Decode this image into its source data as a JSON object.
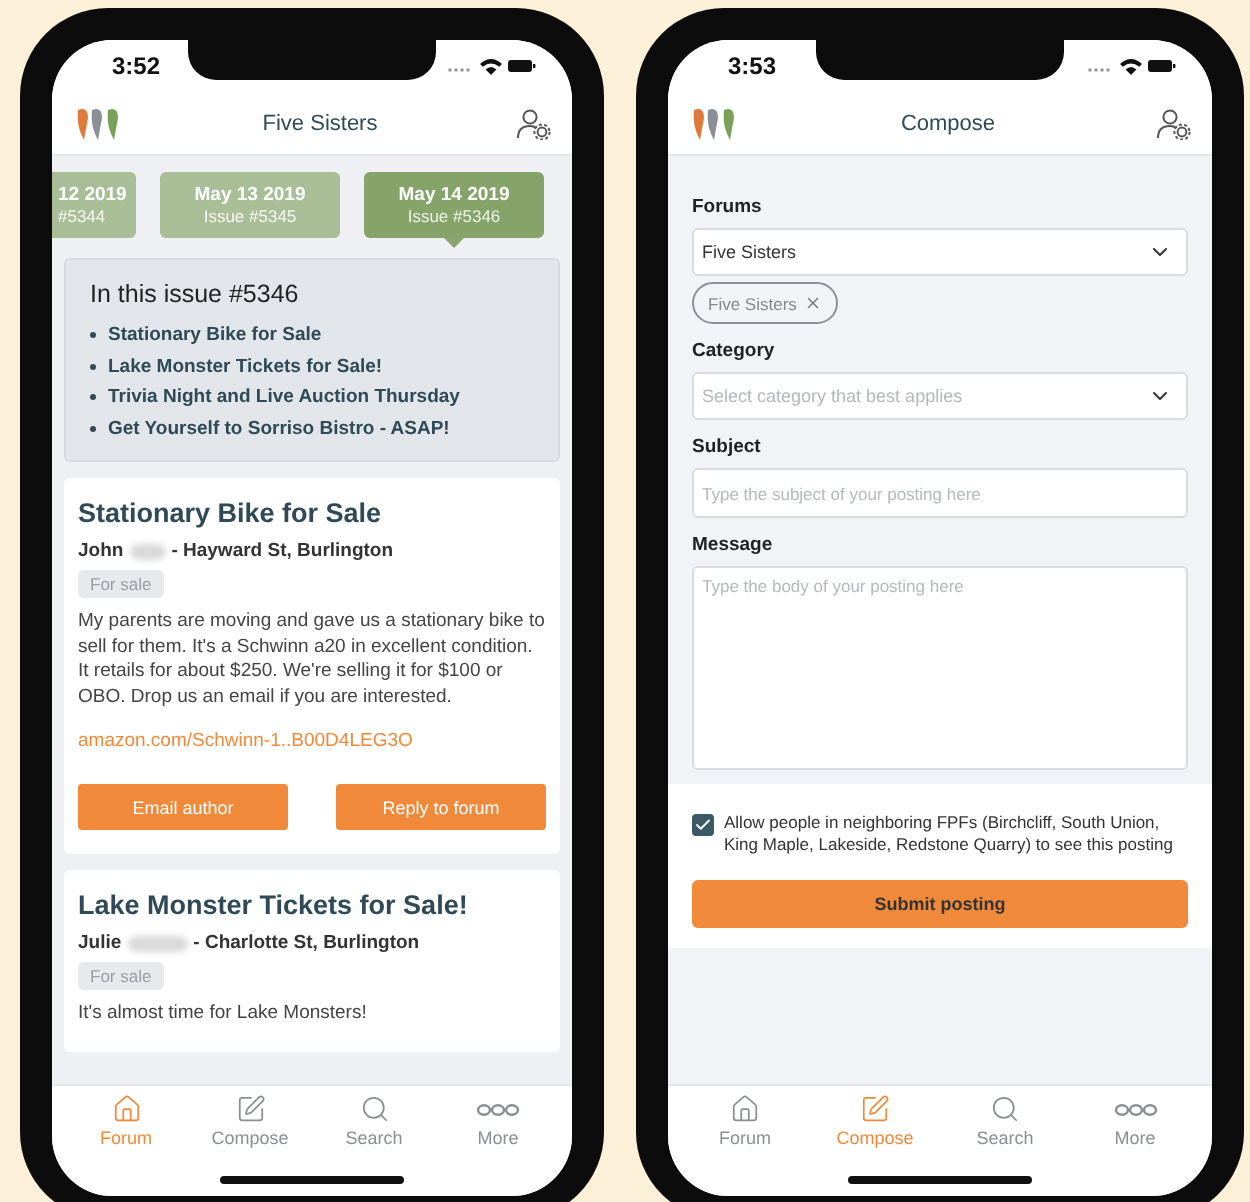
{
  "forum_screen": {
    "status_time": "3:52",
    "title": "Five Sisters",
    "issues": [
      {
        "date": "12 2019",
        "number": "#5344",
        "selected": false
      },
      {
        "date": "May 13 2019",
        "number": "Issue #5345",
        "selected": false
      },
      {
        "date": "May 14 2019",
        "number": "Issue #5346",
        "selected": true
      }
    ],
    "summary": {
      "heading": "In this issue #5346",
      "items": [
        "Stationary Bike for Sale",
        "Lake Monster Tickets for Sale!",
        "Trivia Night and Live Auction Thursday",
        "Get Yourself to Sorriso Bistro - ASAP!"
      ]
    },
    "posts": [
      {
        "title": "Stationary Bike for Sale",
        "author": "John",
        "location": "- Hayward St, Burlington",
        "tag": "For sale",
        "body": "My parents are moving and gave us a stationary bike to sell for them.  It's a Schwinn a20 in excellent condition.  It retails for about $250.  We're selling it for $100 or OBO.  Drop us an email if you are interested.",
        "link": "amazon.com/Schwinn-1..B00D4LEG3O",
        "actions": [
          "Email author",
          "Reply to forum"
        ]
      },
      {
        "title": "Lake Monster Tickets for Sale!",
        "author": "Julie",
        "location": "- Charlotte St, Burlington",
        "tag": "For sale",
        "body": "It's almost time for Lake Monsters!"
      }
    ],
    "tab_bar": [
      {
        "kind": "home",
        "label": "Forum",
        "selected": true
      },
      {
        "kind": "compose",
        "label": "Compose",
        "selected": false
      },
      {
        "kind": "search",
        "label": "Search",
        "selected": false
      },
      {
        "kind": "more",
        "label": "More",
        "selected": false
      }
    ]
  },
  "compose_screen": {
    "status_time": "3:53",
    "title": "Compose",
    "forums": {
      "label": "Forums",
      "value": "Five Sisters"
    },
    "chips": [
      "Five Sisters"
    ],
    "category": {
      "label": "Category",
      "placeholder": "Select category that best applies"
    },
    "subject": {
      "label": "Subject",
      "placeholder": "Type the subject of your posting here"
    },
    "message": {
      "label": "Message",
      "placeholder": "Type the body of your posting here"
    },
    "share": {
      "checked": true,
      "text": "Allow people in neighboring FPFs (Birchcliff, South Union, King Maple, Lakeside, Redstone Quarry) to see this posting"
    },
    "submit": "Submit posting",
    "tab_bar": [
      {
        "kind": "home",
        "label": "Forum",
        "selected": false
      },
      {
        "kind": "compose",
        "label": "Compose",
        "selected": true
      },
      {
        "kind": "search",
        "label": "Search",
        "selected": false
      },
      {
        "kind": "more",
        "label": "More",
        "selected": false
      }
    ]
  }
}
